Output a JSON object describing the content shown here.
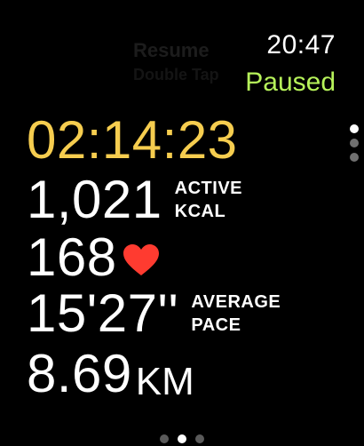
{
  "ghost": {
    "line1": "Resume",
    "line2": "Double Tap"
  },
  "header": {
    "time": "20:47",
    "status": "Paused",
    "status_color": "#b6f25a"
  },
  "metrics": {
    "elapsed": {
      "value": "02:14:23",
      "color": "#f6cd4f"
    },
    "active_energy": {
      "value": "1,021",
      "unit_line1": "ACTIVE",
      "unit_line2": "KCAL"
    },
    "heart_rate": {
      "value": "168",
      "icon": "heart-icon"
    },
    "pace": {
      "value": "15'27''",
      "unit_line1": "AVERAGE",
      "unit_line2": "PACE"
    },
    "distance": {
      "value": "8.69",
      "unit": "KM"
    }
  },
  "scroll_indicator": {
    "count": 3,
    "active_index": 0
  },
  "page_indicator": {
    "count": 3,
    "active_index": 1
  }
}
